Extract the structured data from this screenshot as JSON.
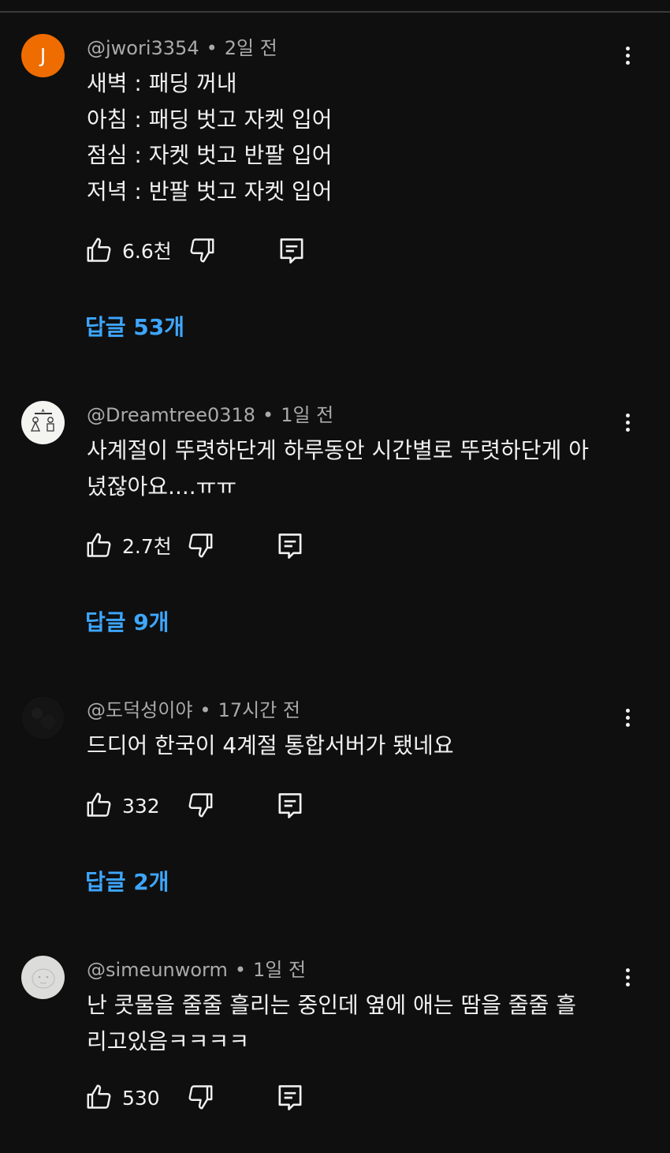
{
  "comments": [
    {
      "avatar_letter": "J",
      "avatar_color": "#ef6c00",
      "handle": "@jwori3354",
      "separator": "•",
      "time": "2일 전",
      "lines": [
        "새벽 : 패딩 꺼내",
        "아침 : 패딩 벗고 자켓 입어",
        "점심 : 자켓 벗고 반팔 입어",
        "저녁 : 반팔 벗고 자켓 입어"
      ],
      "likes": "6.6천",
      "replies": "답글 53개"
    },
    {
      "avatar_icon": "wedding-couple-icon",
      "handle": "@Dreamtree0318",
      "separator": "•",
      "time": "1일 전",
      "lines": [
        "사계절이 뚜렷하단게 하루동안 시간별로 뚜렷하단게 아",
        "녔잖아요....ㅠㅠ"
      ],
      "likes": "2.7천",
      "replies": "답글 9개"
    },
    {
      "avatar_icon": "dark-photo-avatar-icon",
      "handle": "@도덕성이야",
      "separator": "•",
      "time": "17시간 전",
      "lines": [
        "드디어 한국이 4계절 통합서버가 됐네요"
      ],
      "likes": "332",
      "replies": "답글 2개"
    },
    {
      "avatar_icon": "sketch-face-avatar-icon",
      "handle": "@simeunworm",
      "separator": "•",
      "time": "1일 전",
      "lines": [
        "난 콧물을 줄줄 흘리는 중인데 옆에 애는 땀을 줄줄 흘",
        "리고있음ㅋㅋㅋㅋ"
      ],
      "likes": "530"
    }
  ],
  "colors": {
    "background": "#0f0f0f",
    "link": "#3ea6ff",
    "meta": "#aaaaaa",
    "text": "#f1f1f1"
  }
}
